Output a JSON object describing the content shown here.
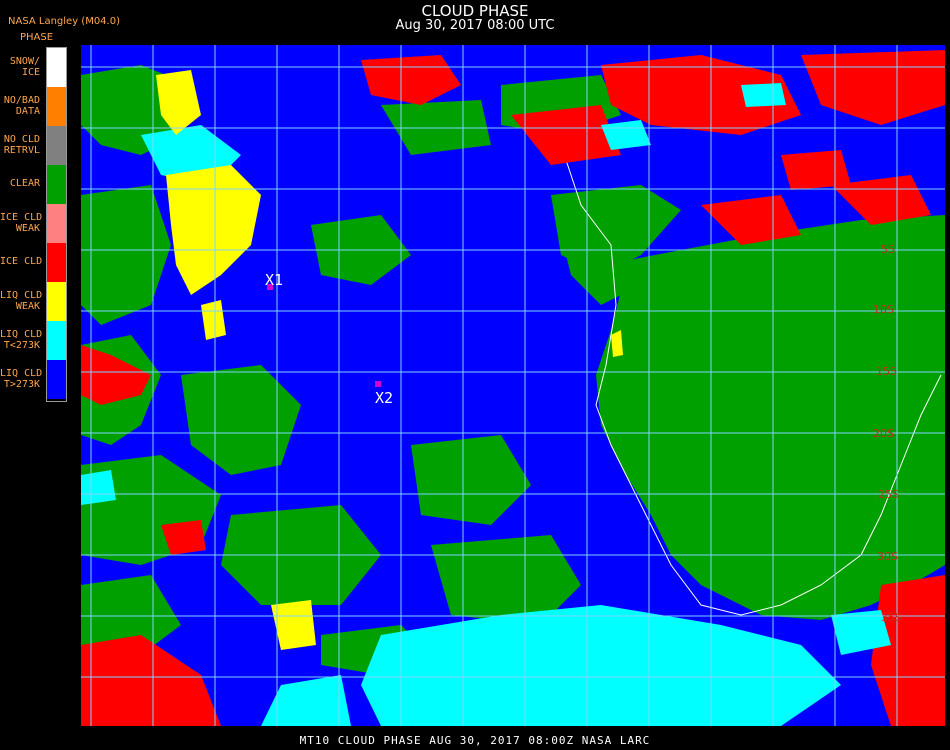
{
  "header": {
    "title": "CLOUD PHASE",
    "subtitle": "Aug 30, 2017 08:00 UTC",
    "source": "NASA Langley (M04.0)",
    "legend_title": "PHASE"
  },
  "legend": [
    {
      "label": "SNOW/\nICE",
      "color": "#ffffff"
    },
    {
      "label": "NO/BAD\nDATA",
      "color": "#ff7f00"
    },
    {
      "label": "NO CLD\nRETRVL",
      "color": "#808080"
    },
    {
      "label": "CLEAR",
      "color": "#00a000"
    },
    {
      "label": "ICE CLD\nWEAK",
      "color": "#ff8080"
    },
    {
      "label": "ICE CLD",
      "color": "#ff0000"
    },
    {
      "label": "LIQ CLD\nWEAK",
      "color": "#ffff00"
    },
    {
      "label": "LIQ CLD\nT<273K",
      "color": "#00ffff"
    },
    {
      "label": "LIQ CLD\nT>273K",
      "color": "#0000ff"
    }
  ],
  "markers": [
    {
      "label": "X1"
    },
    {
      "label": "X2"
    }
  ],
  "lat_labels": [
    "5S",
    "10S",
    "15S",
    "20S",
    "25S",
    "30S",
    "35S"
  ],
  "footer": "MT10  CLOUD PHASE   AUG 30, 2017 08:00Z   NASA LARC",
  "colors": {
    "ocean_liquid": "#0000ff",
    "land_clear": "#00a000",
    "ice": "#ff0000",
    "liquid_cold": "#00ffff",
    "liquid_weak": "#ffff00",
    "grid": "#7fd4ff",
    "lat_label": "#c03020",
    "marker": "#d000d0"
  }
}
